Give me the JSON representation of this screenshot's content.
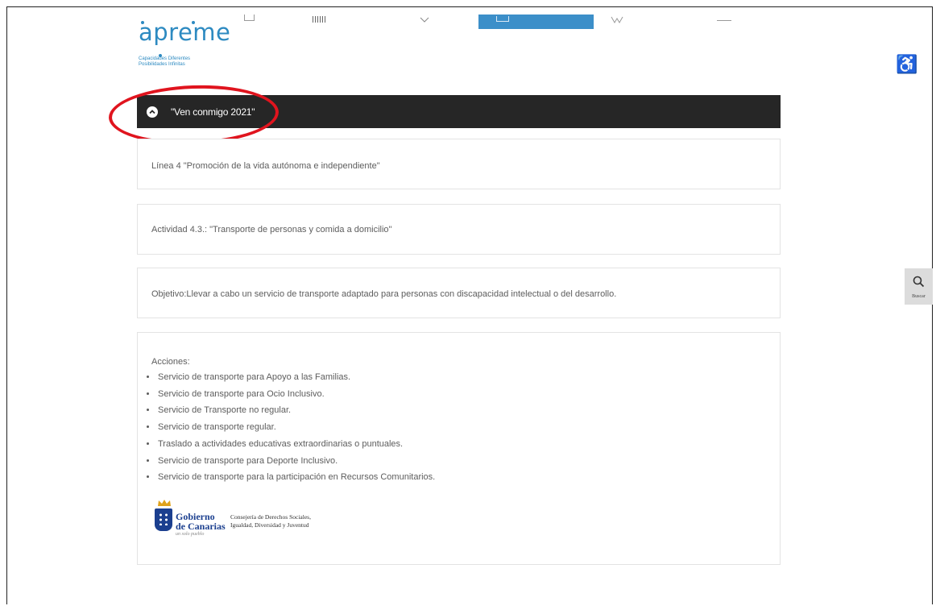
{
  "logo": {
    "wordmark": "apreme",
    "tagline_1": "Capacidades Diferentes",
    "tagline_2": "Posibilidades Infinitas",
    "brand_color": "#2d8ac1"
  },
  "accessibility": {
    "icon": "wheelchair-icon",
    "glyph": "♿"
  },
  "section": {
    "title": "\"Ven conmigo 2021\"",
    "toggle_icon": "chevron-up-circle-icon"
  },
  "cards": {
    "linea": "Línea 4 \"Promoción de la vida autónoma e independiente\"",
    "actividad": "Actividad 4.3.: \"Transporte de personas y comida a domicilio\"",
    "objetivo": "Objetivo:Llevar a cabo un servicio de transporte adaptado para personas con discapacidad intelectual o del desarrollo."
  },
  "acciones": {
    "heading": "Acciones:",
    "items": [
      "Servicio de transporte para Apoyo a las Familias.",
      "Servicio de transporte para Ocio Inclusivo.",
      "Servicio de Transporte no regular.",
      "Servicio de transporte regular.",
      "Traslado a actividades educativas extraordinarias o puntuales.",
      "Servicio de transporte para Deporte Inclusivo.",
      "Servicio de transporte para la participación en Recursos Comunitarios."
    ]
  },
  "gobierno": {
    "name_1": "Gobierno",
    "name_2": "de Canarias",
    "motto": "un solo pueblo",
    "consejeria_1": "Consejería de Derechos Sociales,",
    "consejeria_2": "Igualdad, Diversidad y Juventud"
  },
  "search": {
    "label": "Buscar",
    "icon": "search-icon"
  },
  "colors": {
    "header_bar": "#262626",
    "nav_active": "#3c8fc9",
    "highlight_ring": "#e0141e"
  }
}
